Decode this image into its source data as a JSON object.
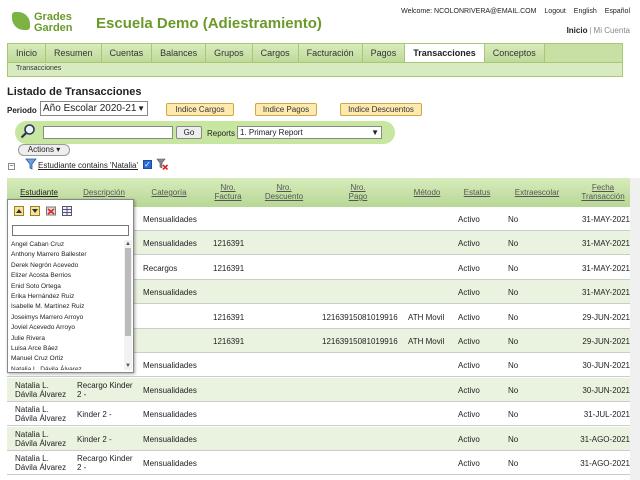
{
  "header": {
    "logo_line1": "Grades",
    "logo_line2": "Garden",
    "school": "Escuela Demo (Adiestramiento)",
    "welcome": "Welcome: NCOLONRIVERA@EMAIL.COM",
    "logout": "Logout",
    "english": "English",
    "espanol": "Español",
    "inicio": "Inicio",
    "sep": "|",
    "mi_cuenta": "Mi Cuenta"
  },
  "nav": {
    "tabs": [
      "Inicio",
      "Resumen",
      "Cuentas",
      "Balances",
      "Grupos",
      "Cargos",
      "Facturación",
      "Pagos",
      "Transacciones",
      "Conceptos"
    ],
    "active": "Transacciones",
    "sub": "Transacciones"
  },
  "page": {
    "title": "Listado de Transacciones",
    "periodo_label": "Periodo",
    "periodo_value": "Año Escolar 2020-21",
    "btn_cargos": "Indice Cargos",
    "btn_pagos": "Indice Pagos",
    "btn_descuentos": "Indice Descuentos"
  },
  "search": {
    "go": "Go",
    "reports_label": "Reports",
    "reports_value": "1. Primary Report",
    "actions": "Actions"
  },
  "filter": {
    "text": "Estudiante contains 'Natalia'",
    "collapse": "−",
    "check": "✓"
  },
  "table": {
    "headers": [
      "Estudiante",
      "Descripción",
      "Categoría",
      "Nro. Factura",
      "Nro. Descuento",
      "Nro. Pago",
      "Método",
      "Estatus",
      "Extraescolar",
      "Fecha Transacción"
    ],
    "rows": [
      {
        "estudiante": "",
        "descripcion": "",
        "categoria": "Mensualidades",
        "factura": "",
        "pago": "",
        "metodo": "",
        "estatus": "Activo",
        "extra": "No",
        "fecha": "31-MAY-2021"
      },
      {
        "estudiante": "",
        "descripcion": "",
        "categoria": "Mensualidades",
        "factura": "1216391",
        "pago": "",
        "metodo": "",
        "estatus": "Activo",
        "extra": "No",
        "fecha": "31-MAY-2021"
      },
      {
        "estudiante": "",
        "descripcion": "",
        "categoria": "Recargos",
        "factura": "1216391",
        "pago": "",
        "metodo": "",
        "estatus": "Activo",
        "extra": "No",
        "fecha": "31-MAY-2021"
      },
      {
        "estudiante": "",
        "descripcion": "",
        "categoria": "Mensualidades",
        "factura": "",
        "pago": "",
        "metodo": "",
        "estatus": "Activo",
        "extra": "No",
        "fecha": "31-MAY-2021"
      },
      {
        "estudiante": "",
        "descripcion": "",
        "categoria": "",
        "factura": "1216391",
        "pago": "12163915081019916",
        "metodo": "ATH Movil",
        "estatus": "Activo",
        "extra": "No",
        "fecha": "29-JUN-2021"
      },
      {
        "estudiante": "",
        "descripcion": "",
        "categoria": "",
        "factura": "1216391",
        "pago": "12163915081019916",
        "metodo": "ATH Movil",
        "estatus": "Activo",
        "extra": "No",
        "fecha": "29-JUN-2021"
      },
      {
        "estudiante": "",
        "descripcion": "",
        "categoria": "Mensualidades",
        "factura": "",
        "pago": "",
        "metodo": "",
        "estatus": "Activo",
        "extra": "No",
        "fecha": "30-JUN-2021"
      },
      {
        "estudiante": "Natalia L. Dávila Álvarez",
        "descripcion": "Recargo Kinder 2 -",
        "categoria": "Mensualidades",
        "factura": "",
        "pago": "",
        "metodo": "",
        "estatus": "Activo",
        "extra": "No",
        "fecha": "30-JUN-2021"
      },
      {
        "estudiante": "Natalia L. Dávila Álvarez",
        "descripcion": "Kinder 2 -",
        "categoria": "Mensualidades",
        "factura": "",
        "pago": "",
        "metodo": "",
        "estatus": "Activo",
        "extra": "No",
        "fecha": "31-JUL-2021"
      },
      {
        "estudiante": "Natalia L. Dávila Álvarez",
        "descripcion": "Kinder 2 -",
        "categoria": "Mensualidades",
        "factura": "",
        "pago": "",
        "metodo": "",
        "estatus": "Activo",
        "extra": "No",
        "fecha": "31-AGO-2021"
      },
      {
        "estudiante": "Natalia L. Dávila Álvarez",
        "descripcion": "Recargo Kinder 2 -",
        "categoria": "Mensualidades",
        "factura": "",
        "pago": "",
        "metodo": "",
        "estatus": "Activo",
        "extra": "No",
        "fecha": "31-AGO-2021"
      }
    ]
  },
  "dropdown": {
    "names": [
      "Angel Caban Cruz",
      "Anthony Marrero Ballester",
      "Derek Negrón Acevedo",
      "Elizer Acosta Berrios",
      "Enid Soto Ortega",
      "Erika Hernández Ruiz",
      "Isabelle M. Martínez Ruiz",
      "Joseimys Marrero Arroyo",
      "Joviel Acevedo Arroyo",
      "Julie Rivera",
      "Luisa Arce Báez",
      "Manuel Cruz Ortiz",
      "Natalia L. Dávila Álvarez"
    ]
  }
}
